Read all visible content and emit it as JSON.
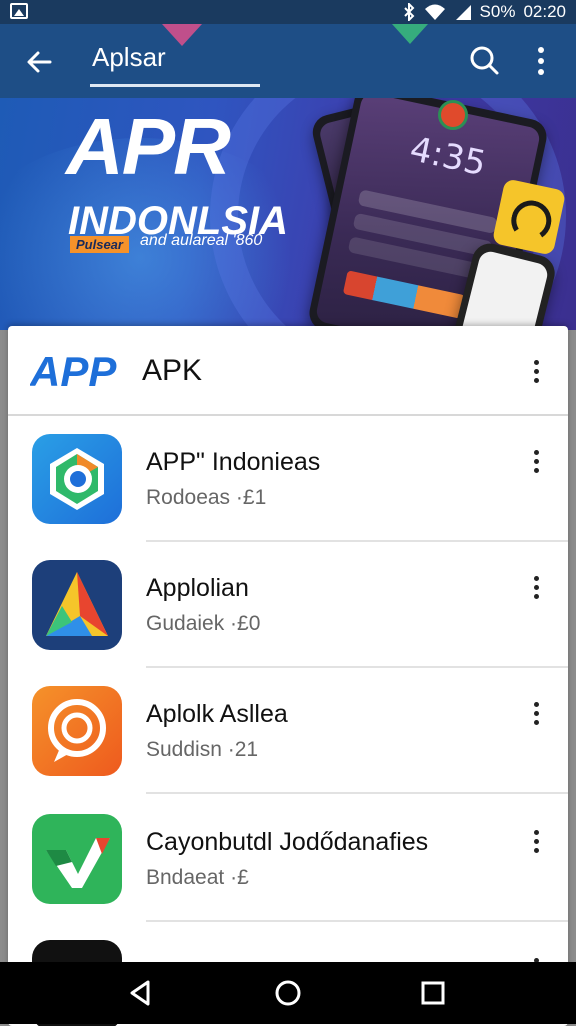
{
  "status_bar": {
    "battery_text": "S0%",
    "time": "02:20",
    "icons": [
      "gallery-icon",
      "bluetooth-icon",
      "wifi-icon",
      "signal-icon"
    ]
  },
  "toolbar": {
    "title": "Aplsar",
    "icons": [
      "arrow-back-icon",
      "search-icon",
      "more-vert-icon"
    ],
    "color": "#1e4e86"
  },
  "banner": {
    "title": "APR",
    "subtitle": "INDONLSIA",
    "tag": "Pulsear",
    "tagline": "and aulareal '860",
    "phone_time": "4:35"
  },
  "section_header": {
    "logo_text": "APP",
    "title": "APK"
  },
  "apps": [
    {
      "title": "APP\" Indonieas",
      "subtitle": "Rodoeas  ·£1",
      "icon": "shield-hex-icon"
    },
    {
      "title": "Applolian",
      "subtitle": "Gudaiek  ·£0",
      "icon": "triangle-a-icon"
    },
    {
      "title": "Aplolk Asllea",
      "subtitle": "Suddisn  ·21",
      "icon": "chat-bubble-icon"
    },
    {
      "title": "Cayonbutdl Jodődanafies",
      "subtitle": "Bndaeat  ·£",
      "icon": "check-v-icon"
    }
  ],
  "nav_bar": {
    "icons": [
      "nav-back-icon",
      "nav-home-icon",
      "nav-recents-icon"
    ]
  }
}
